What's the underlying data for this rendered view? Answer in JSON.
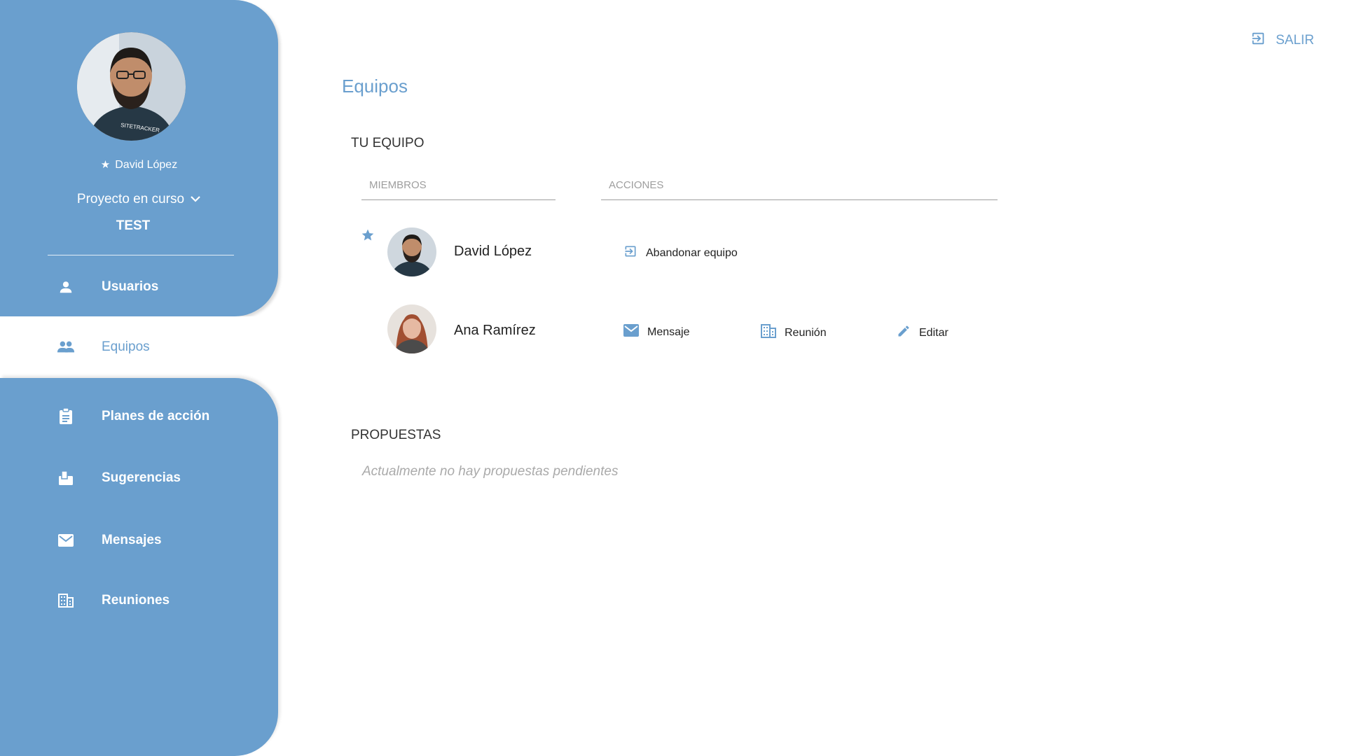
{
  "sidebar": {
    "user_name": "David López",
    "project_label": "Proyecto en curso",
    "project_name": "TEST",
    "items": [
      {
        "label": "Usuarios",
        "icon": "person-icon"
      },
      {
        "label": "Equipos",
        "icon": "group-icon",
        "active": true
      },
      {
        "label": "Planes de acción",
        "icon": "clipboard-icon"
      },
      {
        "label": "Sugerencias",
        "icon": "suggestion-box-icon"
      },
      {
        "label": "Mensajes",
        "icon": "mail-icon"
      },
      {
        "label": "Reuniones",
        "icon": "building-icon"
      }
    ]
  },
  "header": {
    "exit_label": "SALIR",
    "page_title": "Equipos"
  },
  "team": {
    "section_title": "TU EQUIPO",
    "col_members": "MIEMBROS",
    "col_actions": "ACCIONES",
    "members": [
      {
        "name": "David López",
        "leader": true,
        "actions": [
          "Abandonar equipo"
        ]
      },
      {
        "name": "Ana Ramírez",
        "leader": false,
        "actions": [
          "Mensaje",
          "Reunión",
          "Editar"
        ]
      }
    ]
  },
  "proposals": {
    "section_title": "PROPUESTAS",
    "empty_text": "Actualmente no hay propuestas pendientes"
  },
  "colors": {
    "accent": "#6a9fce",
    "text": "#222222",
    "muted": "#9e9e9e"
  }
}
